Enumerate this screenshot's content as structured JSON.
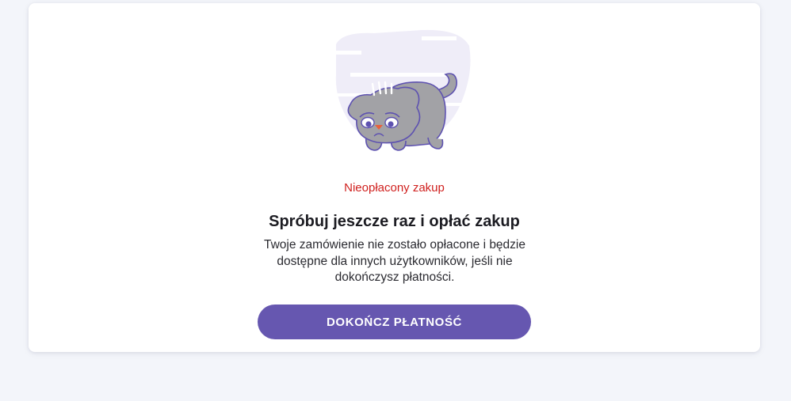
{
  "payment": {
    "illustration_icon": "sad-cat-icon",
    "status_label": "Nieopłacony zakup",
    "status_color": "#d0201e",
    "title": "Spróbuj jeszcze raz i opłać zakup",
    "description": "Twoje zamówienie nie zostało opłacone i będzie dostępne dla innych użytkowników, jeśli nie dokończysz płatności.",
    "cta_label": "DOKOŃCZ PŁATNOŚĆ",
    "accent_color": "#6657b0"
  }
}
